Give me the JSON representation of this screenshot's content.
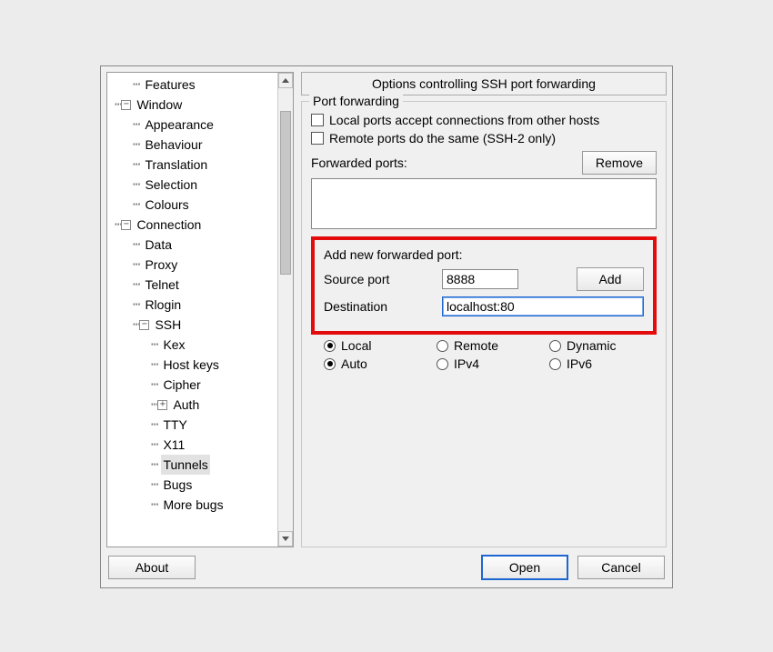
{
  "tree": {
    "items": [
      {
        "indent": 2,
        "exp": "",
        "label": "Features"
      },
      {
        "indent": 1,
        "exp": "-",
        "label": "Window"
      },
      {
        "indent": 2,
        "exp": "",
        "label": "Appearance"
      },
      {
        "indent": 2,
        "exp": "",
        "label": "Behaviour"
      },
      {
        "indent": 2,
        "exp": "",
        "label": "Translation"
      },
      {
        "indent": 2,
        "exp": "",
        "label": "Selection"
      },
      {
        "indent": 2,
        "exp": "",
        "label": "Colours"
      },
      {
        "indent": 1,
        "exp": "-",
        "label": "Connection"
      },
      {
        "indent": 2,
        "exp": "",
        "label": "Data"
      },
      {
        "indent": 2,
        "exp": "",
        "label": "Proxy"
      },
      {
        "indent": 2,
        "exp": "",
        "label": "Telnet"
      },
      {
        "indent": 2,
        "exp": "",
        "label": "Rlogin"
      },
      {
        "indent": 2,
        "exp": "-",
        "label": "SSH"
      },
      {
        "indent": 3,
        "exp": "",
        "label": "Kex"
      },
      {
        "indent": 3,
        "exp": "",
        "label": "Host keys"
      },
      {
        "indent": 3,
        "exp": "",
        "label": "Cipher"
      },
      {
        "indent": 3,
        "exp": "+",
        "label": "Auth"
      },
      {
        "indent": 3,
        "exp": "",
        "label": "TTY"
      },
      {
        "indent": 3,
        "exp": "",
        "label": "X11"
      },
      {
        "indent": 3,
        "exp": "",
        "label": "Tunnels",
        "selected": true
      },
      {
        "indent": 3,
        "exp": "",
        "label": "Bugs"
      },
      {
        "indent": 3,
        "exp": "",
        "label": "More bugs"
      }
    ]
  },
  "panel": {
    "title": "Options controlling SSH port forwarding",
    "group_title": "Port forwarding",
    "chk_local": "Local ports accept connections from other hosts",
    "chk_remote": "Remote ports do the same (SSH-2 only)",
    "forwarded_label": "Forwarded ports:",
    "remove_btn": "Remove",
    "add_title": "Add new forwarded port:",
    "source_label": "Source port",
    "source_value": "8888",
    "dest_label": "Destination",
    "dest_value": "localhost:80",
    "add_btn": "Add",
    "radio1": [
      "Local",
      "Remote",
      "Dynamic"
    ],
    "radio1_selected": 0,
    "radio2": [
      "Auto",
      "IPv4",
      "IPv6"
    ],
    "radio2_selected": 0
  },
  "footer": {
    "about": "About",
    "open": "Open",
    "cancel": "Cancel"
  }
}
